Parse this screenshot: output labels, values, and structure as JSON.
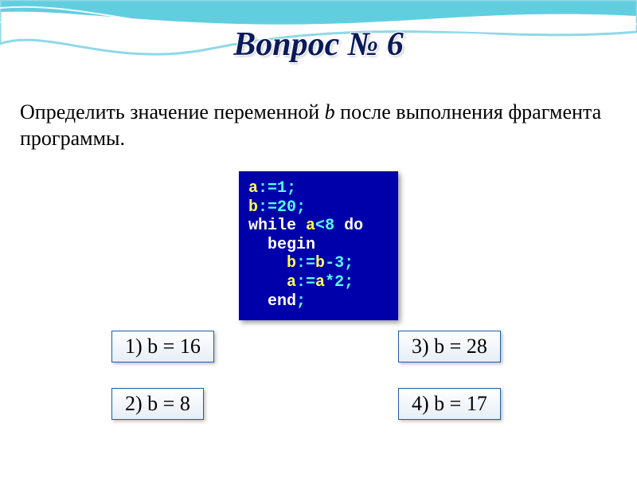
{
  "title": "Вопрос № 6",
  "question": {
    "prefix": "Определить значение переменной ",
    "variable": "b",
    "suffix": " после выполнения фрагмента программы."
  },
  "code": {
    "line1": {
      "a": "a",
      "assign": ":=",
      "v": "1",
      "semi": ";"
    },
    "line2": {
      "b": "b",
      "assign": ":=",
      "v": "20",
      "semi": ";"
    },
    "line3": {
      "while": "while",
      "cond_l": "a",
      "cond_op": "<",
      "cond_r": "8",
      "do": "do"
    },
    "line4": {
      "begin": "begin"
    },
    "line5": {
      "lhs": "b",
      "assign": ":=",
      "rhs_l": "b",
      "rhs_op": "-",
      "rhs_r": "3",
      "semi": ";"
    },
    "line6": {
      "lhs": "a",
      "assign": ":=",
      "rhs_l": "a",
      "rhs_op": "*",
      "rhs_r": "2",
      "semi": ";"
    },
    "line7": {
      "end": "end",
      "semi": ";"
    }
  },
  "answers": {
    "a1": "1) b = 16",
    "a2": "2) b = 8",
    "a3": "3) b = 28",
    "a4": "4) b = 17"
  }
}
